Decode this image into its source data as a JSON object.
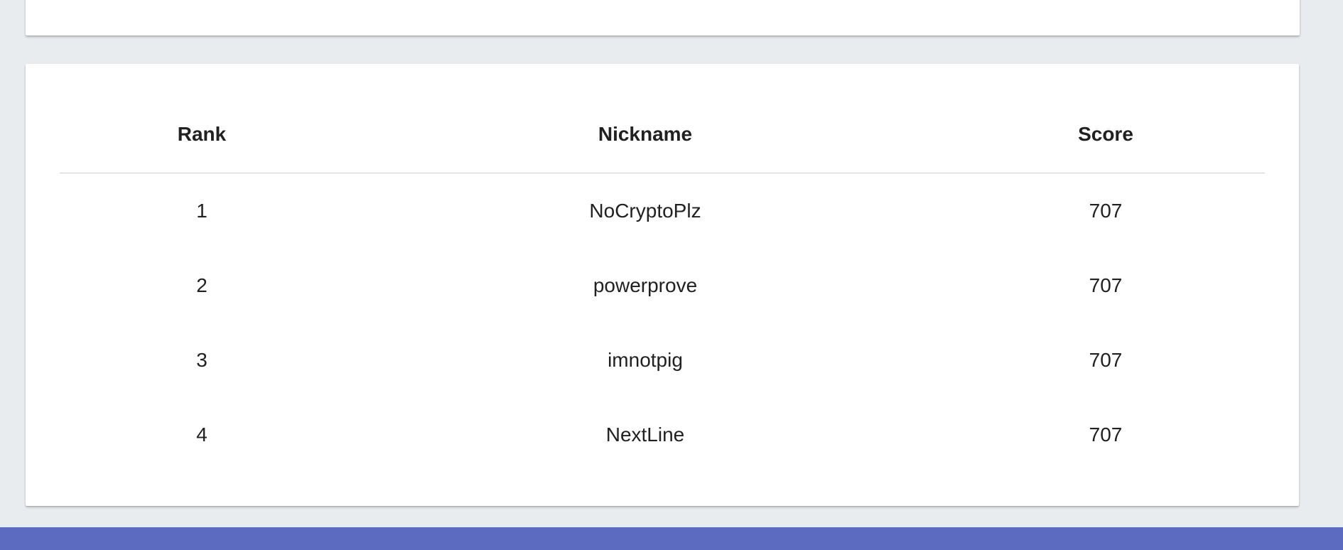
{
  "leaderboard": {
    "headers": {
      "rank": "Rank",
      "nickname": "Nickname",
      "score": "Score"
    },
    "rows": [
      {
        "rank": "1",
        "nickname": "NoCryptoPlz",
        "score": "707"
      },
      {
        "rank": "2",
        "nickname": "powerprove",
        "score": "707"
      },
      {
        "rank": "3",
        "nickname": "imnotpig",
        "score": "707"
      },
      {
        "rank": "4",
        "nickname": "NextLine",
        "score": "707"
      }
    ]
  },
  "colors": {
    "page_background": "#e8ecef",
    "card_background": "#ffffff",
    "footer_accent": "#5c6bc0"
  }
}
